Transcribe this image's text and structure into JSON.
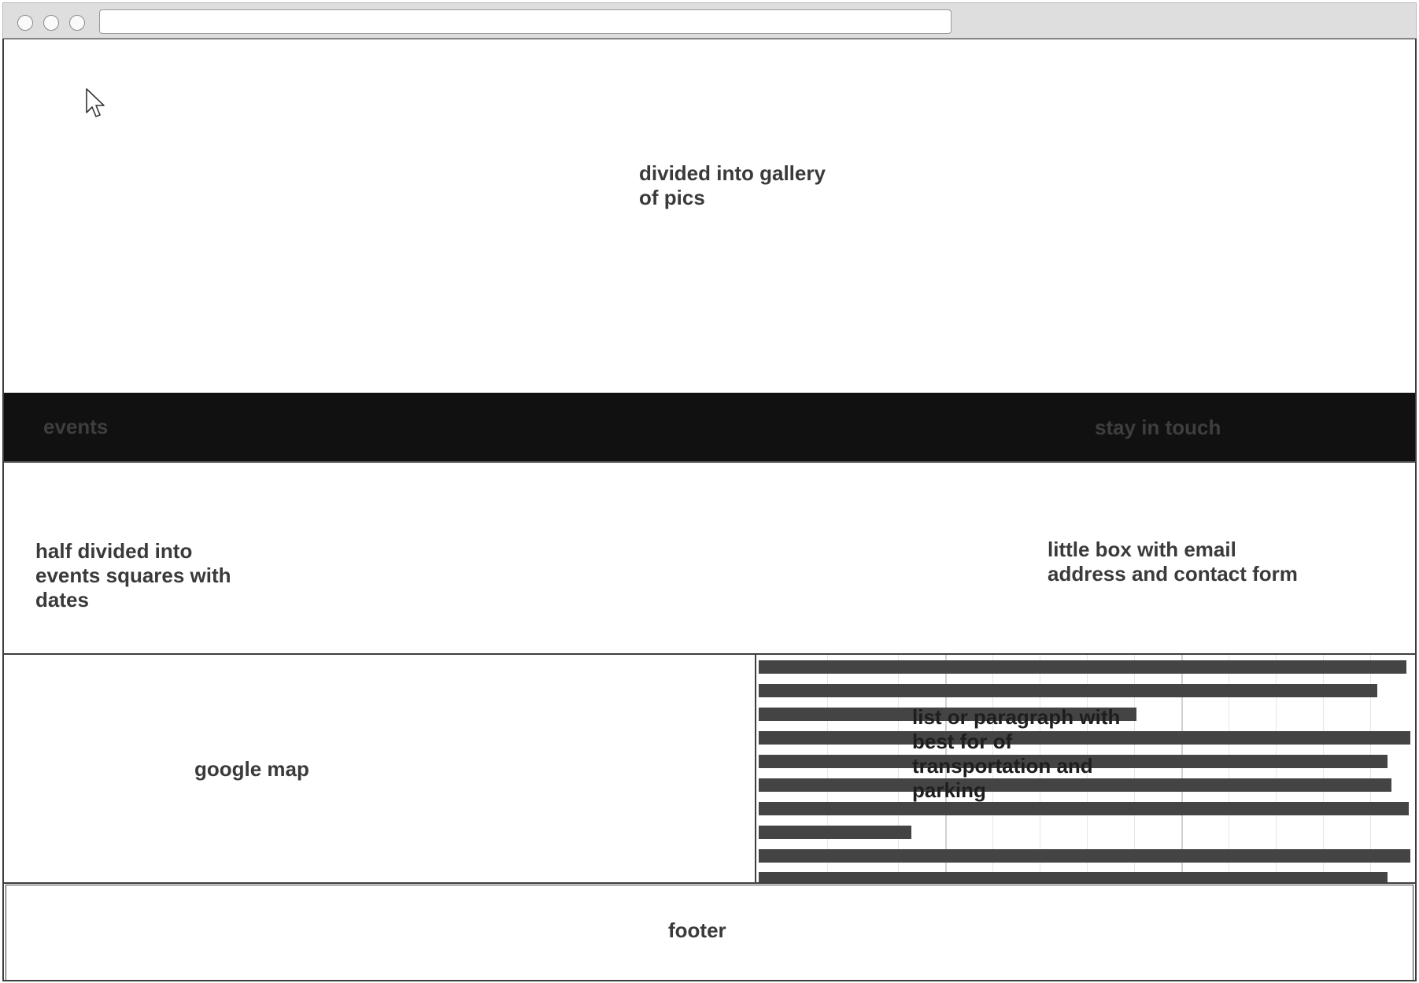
{
  "hero": {
    "note": "divided into gallery\nof pics"
  },
  "nav_bar": {
    "left_label": "events",
    "right_label": "stay in touch"
  },
  "middle": {
    "events_note": "half divided into\nevents squares with\ndates",
    "contact_note": "little box with email\naddress and contact form"
  },
  "map": {
    "label": "google map"
  },
  "transport": {
    "note": "list or paragraph with\nbest for of\ntransportation and\nparking"
  },
  "footer": {
    "label": "footer"
  },
  "icons": {
    "cursor": "mouse-pointer-icon"
  }
}
